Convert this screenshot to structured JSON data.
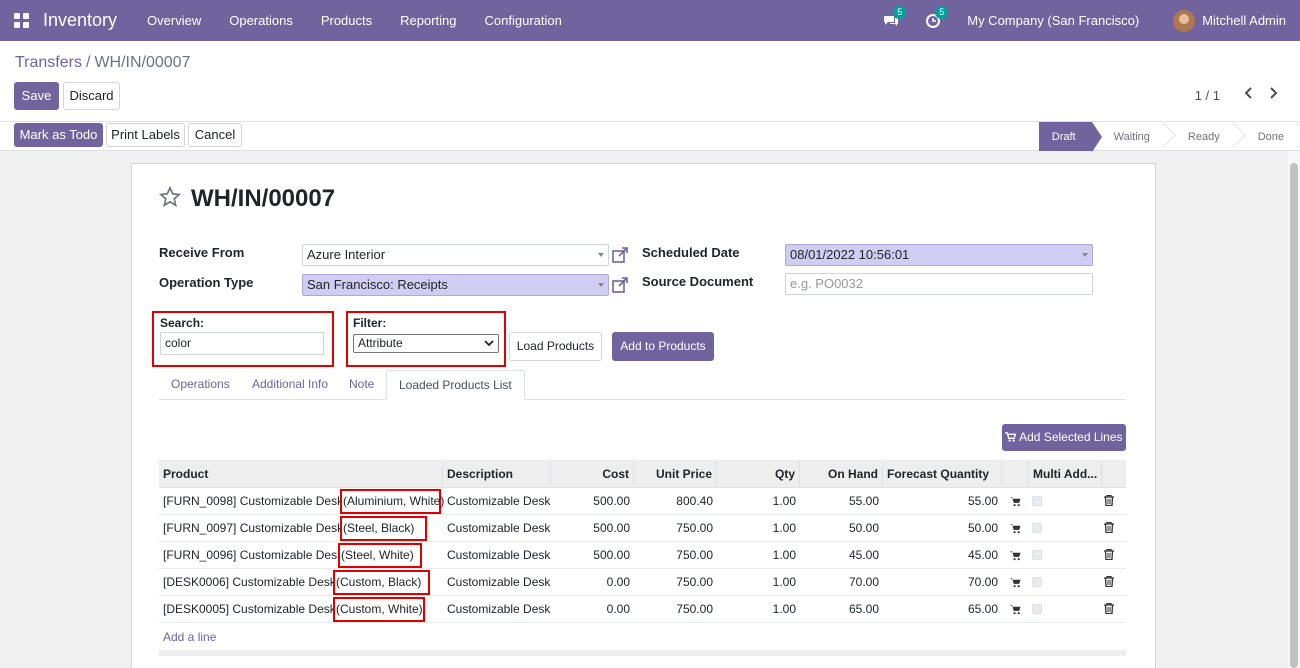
{
  "navbar": {
    "app_name": "Inventory",
    "menu": [
      "Overview",
      "Operations",
      "Products",
      "Reporting",
      "Configuration"
    ],
    "chat_count": "5",
    "activity_count": "5",
    "company": "My Company (San Francisco)",
    "user": "Mitchell Admin"
  },
  "breadcrumb": {
    "parent": "Transfers",
    "separator": "/",
    "current": "WH/IN/00007"
  },
  "actions": {
    "save": "Save",
    "discard": "Discard"
  },
  "pager": {
    "value": "1 / 1"
  },
  "statusbar": {
    "buttons": {
      "mark_todo": "Mark as Todo",
      "print_labels": "Print Labels",
      "cancel": "Cancel"
    },
    "stages": [
      "Draft",
      "Waiting",
      "Ready",
      "Done"
    ],
    "active_stage": "Draft"
  },
  "form": {
    "title": "WH/IN/00007",
    "receive_from_label": "Receive From",
    "receive_from_value": "Azure Interior",
    "operation_type_label": "Operation Type",
    "operation_type_value": "San Francisco: Receipts",
    "scheduled_date_label": "Scheduled Date",
    "scheduled_date_value": "08/01/2022 10:56:01",
    "source_doc_label": "Source Document",
    "source_doc_placeholder": "e.g. PO0032",
    "search_label": "Search:",
    "search_value": "color",
    "filter_label": "Filter:",
    "filter_value": "Attribute",
    "load_products": "Load Products",
    "add_to_products": "Add to Products"
  },
  "tabs": [
    "Operations",
    "Additional Info",
    "Note",
    "Loaded Products List"
  ],
  "active_tab": "Loaded Products List",
  "add_selected_lines": "Add Selected Lines",
  "table": {
    "headers": [
      "Product",
      "Description",
      "Cost",
      "Unit Price",
      "Qty",
      "On Hand",
      "Forecast Quantity",
      "",
      "Multi Add..."
    ],
    "rows": [
      {
        "product": "[FURN_0098] Customizable Desk",
        "variant": "(Aluminium, White)",
        "description": "Customizable Desk",
        "cost": "500.00",
        "unit_price": "800.40",
        "qty": "1.00",
        "on_hand": "55.00",
        "forecast": "55.00"
      },
      {
        "product": "[FURN_0097] Customizable Desk",
        "variant": "(Steel, Black)",
        "description": "Customizable Desk",
        "cost": "500.00",
        "unit_price": "750.00",
        "qty": "1.00",
        "on_hand": "50.00",
        "forecast": "50.00"
      },
      {
        "product": "[FURN_0096] Customizable Desk",
        "variant": "(Steel, White)",
        "description": "Customizable Desk",
        "cost": "500.00",
        "unit_price": "750.00",
        "qty": "1.00",
        "on_hand": "45.00",
        "forecast": "45.00"
      },
      {
        "product": "[DESK0006] Customizable Desk",
        "variant": "(Custom, Black)",
        "description": "Customizable Desk",
        "cost": "0.00",
        "unit_price": "750.00",
        "qty": "1.00",
        "on_hand": "70.00",
        "forecast": "70.00"
      },
      {
        "product": "[DESK0005] Customizable Desk",
        "variant": "(Custom, White)",
        "description": "Customizable Desk",
        "cost": "0.00",
        "unit_price": "750.00",
        "qty": "1.00",
        "on_hand": "65.00",
        "forecast": "65.00"
      }
    ],
    "add_line": "Add a line"
  },
  "colors": {
    "brand": "#71639e",
    "highlight": "#d1ccf1",
    "annotation": "#e00000"
  },
  "icons": [
    "apps-grid-icon",
    "chat-icon",
    "activity-clock-icon",
    "star-icon",
    "external-link-icon",
    "caret-down-icon",
    "chevron-left-icon",
    "chevron-right-icon",
    "cart-icon",
    "trash-icon"
  ]
}
